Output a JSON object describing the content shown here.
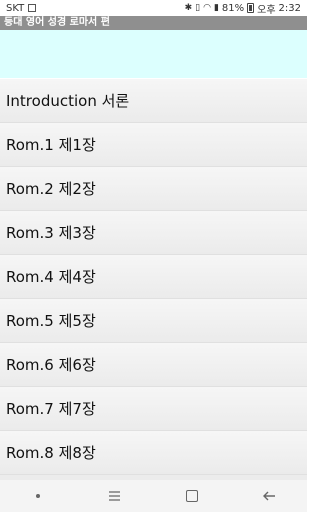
{
  "status_bar": {
    "carrier": "SKT",
    "battery": "81%",
    "time_prefix": "오후",
    "time": "2:32",
    "icons": [
      "bluetooth-icon",
      "vibrate-icon",
      "wifi-icon",
      "signal-icon",
      "battery-icon"
    ]
  },
  "header": {
    "title": "등대 영어 성경 로마서 편"
  },
  "list": {
    "items": [
      {
        "label": "Introduction 서론"
      },
      {
        "label": "Rom.1 제1장"
      },
      {
        "label": "Rom.2 제2장"
      },
      {
        "label": "Rom.3 제3장"
      },
      {
        "label": "Rom.4 제4장"
      },
      {
        "label": "Rom.5 제5장"
      },
      {
        "label": "Rom.6 제6장"
      },
      {
        "label": "Rom.7 제7장"
      },
      {
        "label": "Rom.8 제8장"
      },
      {
        "label": ""
      }
    ]
  },
  "nav_bar": {
    "buttons": [
      "dot-icon",
      "recents-back-icon",
      "recent-apps-icon",
      "back-arrow-icon"
    ]
  },
  "colors": {
    "header_bg": "#dcfffe",
    "title_bar_bg": "#8f8f8f",
    "list_bg": "#f0f0f0"
  }
}
